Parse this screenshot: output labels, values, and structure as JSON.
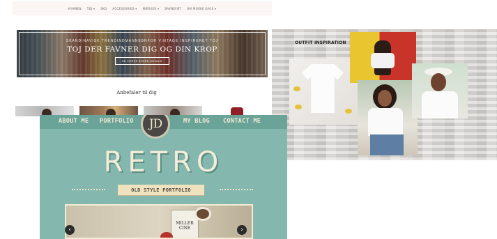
{
  "shop": {
    "nav": [
      "HYMNEN",
      "TØJ ▾",
      "SKO",
      "ACCESSORIES ▾",
      "MÆRKER ▾",
      "BAVNEFØT",
      "OM MORKE KAGE ▾"
    ],
    "hero_kicker": "SKANDINAVISK TRENDINDMANNEBNFOR VINTAGE INSPIRERET TOJ",
    "hero_title": "TOJ DER FAVNER DIG OG DIN KROP",
    "hero_button": "SE VORES STORE UDVALG",
    "recommend_heading": "Anbefaler til dig"
  },
  "outfit": {
    "title": "OUTFIT INSPIRATION"
  },
  "retro": {
    "nav_about": "ABOUT ME",
    "nav_portfolio": "PORTFOLIO",
    "logo": "JD",
    "nav_blog": "MY BLOG",
    "nav_contact": "CONTACT ME",
    "title": "RETRO",
    "ribbon": "OLD STYLE PORTFOLIO",
    "book_line1": "MILLER",
    "book_line2": "CINE",
    "arrow_prev": "‹",
    "arrow_next": "›"
  }
}
